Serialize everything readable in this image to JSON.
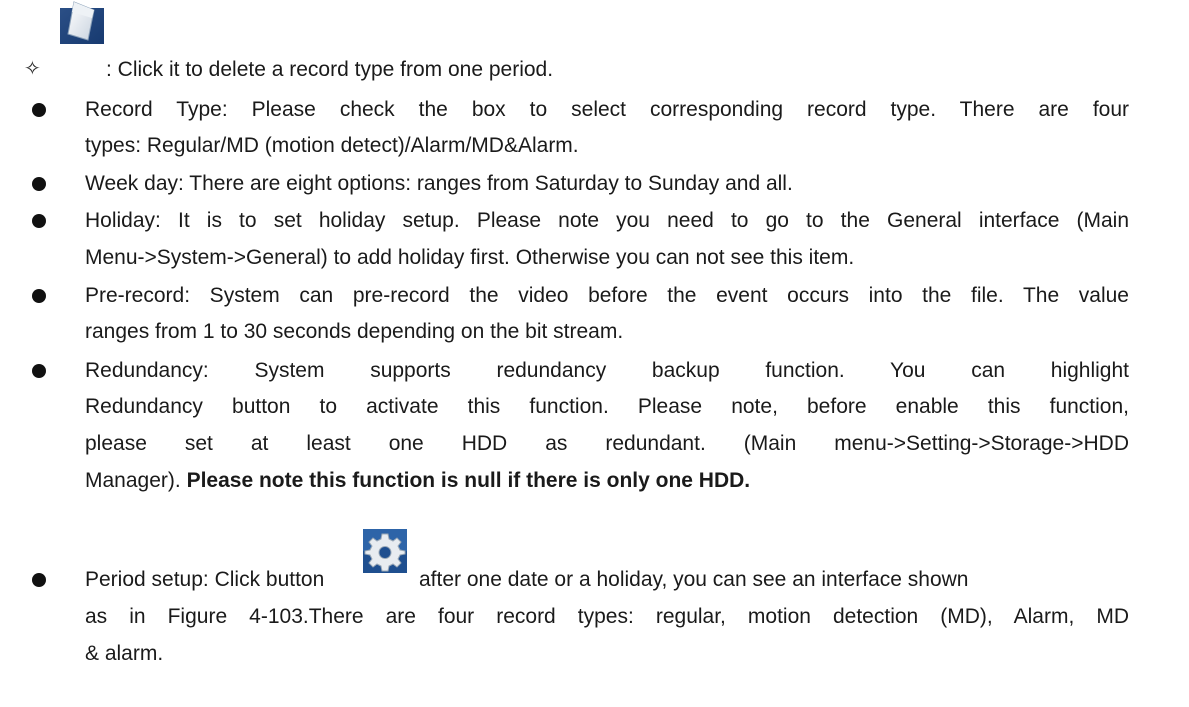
{
  "items": {
    "delete_type": {
      "text": ": Click it to delete a record type from one period.",
      "icon": "eraser-icon"
    },
    "record_type": {
      "line1": "Record Type: Please check the box to select corresponding record type. There are four",
      "line2": "types: Regular/MD (motion detect)/Alarm/MD&Alarm."
    },
    "week_day": {
      "line1": "Week day: There are eight options: ranges from Saturday to Sunday and all."
    },
    "holiday": {
      "line1": "Holiday: It is to set holiday setup. Please note you need to go to the General interface (Main",
      "line2": "Menu->System->General) to add holiday first. Otherwise you can not see this item."
    },
    "pre_record": {
      "line1": "Pre-record: System can pre-record the video before the event occurs into the file. The value",
      "line2": "ranges from 1 to 30 seconds depending on the bit stream."
    },
    "redundancy": {
      "line1": "Redundancy: System supports redundancy backup function.  You can highlight",
      "line2": "Redundancy button to activate this function. Please note, before enable this function,",
      "line3": "please set at least one HDD as redundant. (Main menu->Setting->Storage->HDD",
      "line4_normal": "Manager).",
      "line4_bold": "Please note this function is null if there is only one HDD."
    },
    "period_setup": {
      "line1_before": "Period setup: Click button",
      "line1_after": "after one date or a holiday, you can see an interface shown",
      "line2": "as in Figure 4-103.There are four record types: regular, motion detection (MD), Alarm, MD",
      "line3": "& alarm.",
      "icon": "gear-icon"
    }
  }
}
